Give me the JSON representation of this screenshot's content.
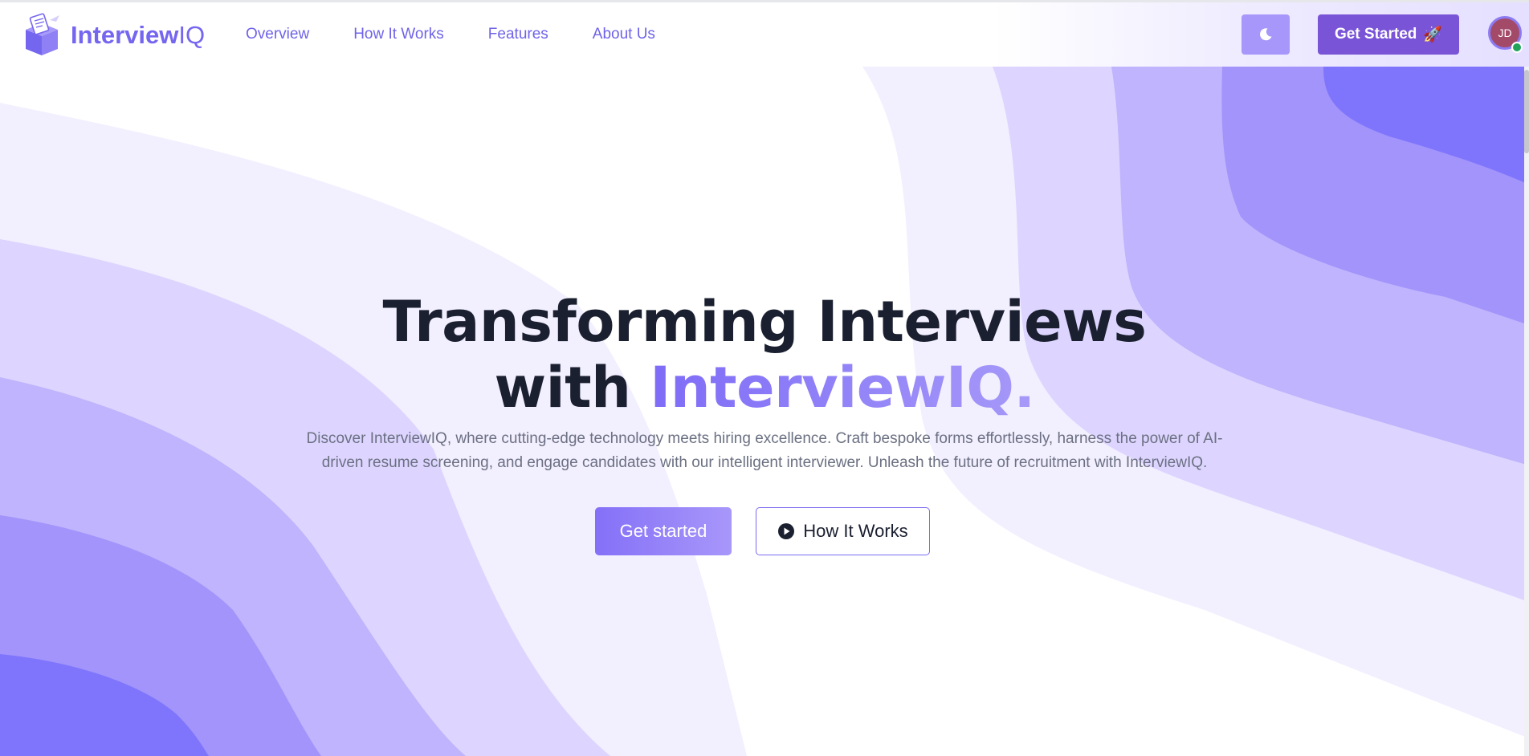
{
  "brand": {
    "name_bold": "Interview",
    "name_regular": "IQ"
  },
  "nav": {
    "links": [
      {
        "label": "Overview"
      },
      {
        "label": "How It Works"
      },
      {
        "label": "Features"
      },
      {
        "label": "About Us"
      }
    ],
    "cta_label": "Get Started",
    "cta_emoji": "🚀",
    "avatar_initials": "JD"
  },
  "hero": {
    "title_line1": "Transforming Interviews",
    "title_line2_prefix": "with ",
    "title_accent": "InterviewIQ.",
    "description": "Discover InterviewIQ, where cutting-edge technology meets hiring excellence. Craft bespoke forms effortlessly, harness the power of AI-driven resume screening, and engage candidates with our intelligent interviewer. Unleash the future of recruitment with InterviewIQ.",
    "primary_button": "Get started",
    "secondary_button": "How It Works"
  },
  "icons": {
    "theme_toggle": "moon-icon",
    "secondary_button_icon": "play-circle-icon",
    "logo": "box-logo-icon"
  },
  "colors": {
    "accent": "#7566f0",
    "cta": "#7a54d6",
    "theme_button": "#a797fa",
    "title": "#1b2030",
    "wave_1": "#f2efff",
    "wave_2": "#ddd5ff",
    "wave_3": "#bfb4fd",
    "wave_4": "#a294fb",
    "wave_5": "#7f75fc"
  }
}
